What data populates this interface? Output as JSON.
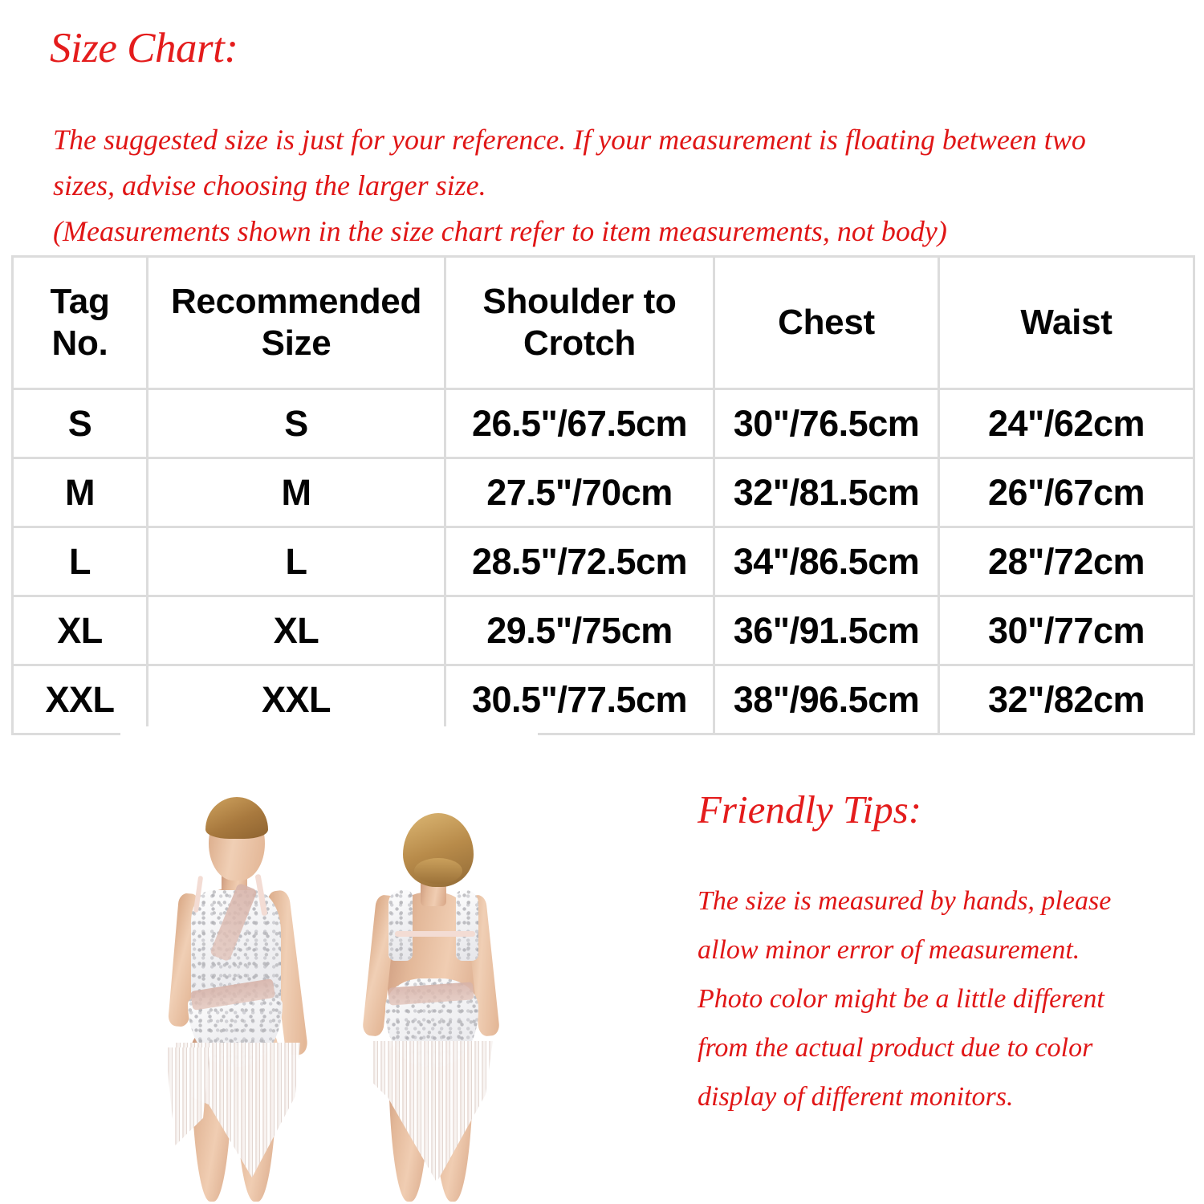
{
  "colors": {
    "accent_red": "#e01616",
    "table_border": "#dcdcdc",
    "table_text": "#040404",
    "page_background": "#ffffff"
  },
  "header": {
    "title": "Size Chart:"
  },
  "intro": {
    "line1": "The suggested size is just for your reference. If your measurement is floating between two",
    "line2": "sizes, advise choosing the larger size.",
    "line3": "(Measurements shown in the size chart refer to item measurements, not body)"
  },
  "size_table": {
    "columns": [
      "Tag No.",
      "Recommended Size",
      "Shoulder to Crotch",
      "Chest",
      "Waist"
    ],
    "columns_multiline": [
      [
        "Tag",
        "No."
      ],
      [
        "Recommended",
        "Size"
      ],
      [
        "Shoulder to",
        "Crotch"
      ],
      [
        "Chest"
      ],
      [
        "Waist"
      ]
    ],
    "rows": [
      {
        "tag_no": "S",
        "recommended_size": "S",
        "shoulder_to_crotch": "26.5\"/67.5cm",
        "chest": "30\"/76.5cm",
        "waist": "24\"/62cm"
      },
      {
        "tag_no": "M",
        "recommended_size": "M",
        "shoulder_to_crotch": "27.5\"/70cm",
        "chest": "32\"/81.5cm",
        "waist": "26\"/67cm"
      },
      {
        "tag_no": "L",
        "recommended_size": "L",
        "shoulder_to_crotch": "28.5\"/72.5cm",
        "chest": "34\"/86.5cm",
        "waist": "28\"/72cm"
      },
      {
        "tag_no": "XL",
        "recommended_size": "XL",
        "shoulder_to_crotch": "29.5\"/75cm",
        "chest": "36\"/91.5cm",
        "waist": "30\"/77cm"
      },
      {
        "tag_no": "XXL",
        "recommended_size": "XXL",
        "shoulder_to_crotch": "30.5\"/77.5cm",
        "chest": "38\"/96.5cm",
        "waist": "32\"/82cm"
      }
    ]
  },
  "tips": {
    "title": "Friendly Tips:",
    "line1": "The size is measured by hands, please",
    "line2": "allow minor error of measurement.",
    "line3": "Photo color might be a little different",
    "line4": "from the actual product due to color",
    "line5": "display of different monitors."
  },
  "product_photo": {
    "description": "Two female models wearing a white sequined fringe dance leotard dress",
    "views": [
      "front view",
      "back view"
    ]
  }
}
